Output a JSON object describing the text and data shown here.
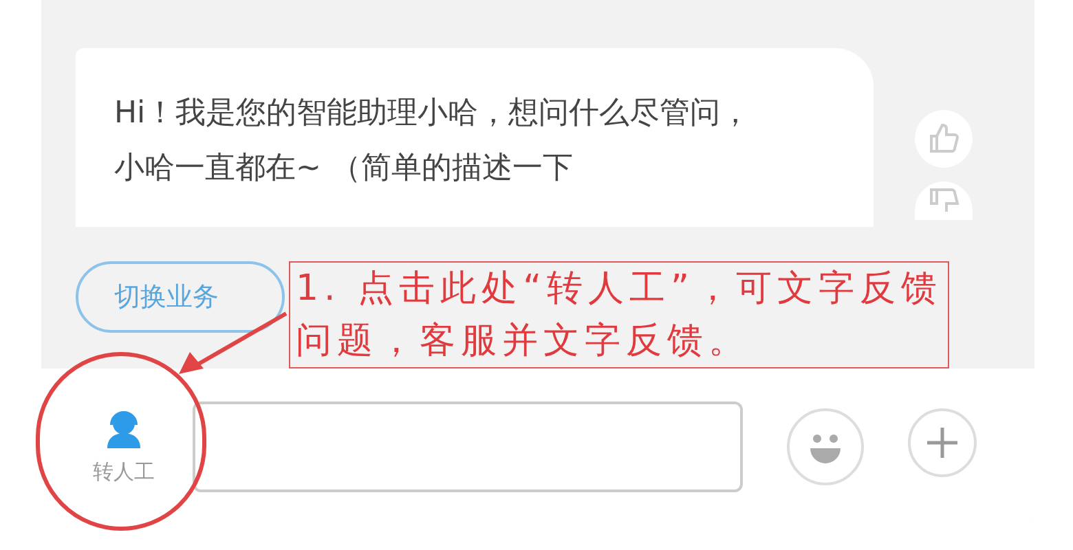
{
  "message": {
    "text": "Hi！我是您的智能助理小哈，想问什么尽管问，小哈一直都在~ （简单的描述一下"
  },
  "switch_button": {
    "label": "切换业务"
  },
  "agent_button": {
    "label": "转人工"
  },
  "annotation": {
    "text": "1. 点击此处“转人工”，可文字反馈问题，客服并文字反馈。"
  }
}
